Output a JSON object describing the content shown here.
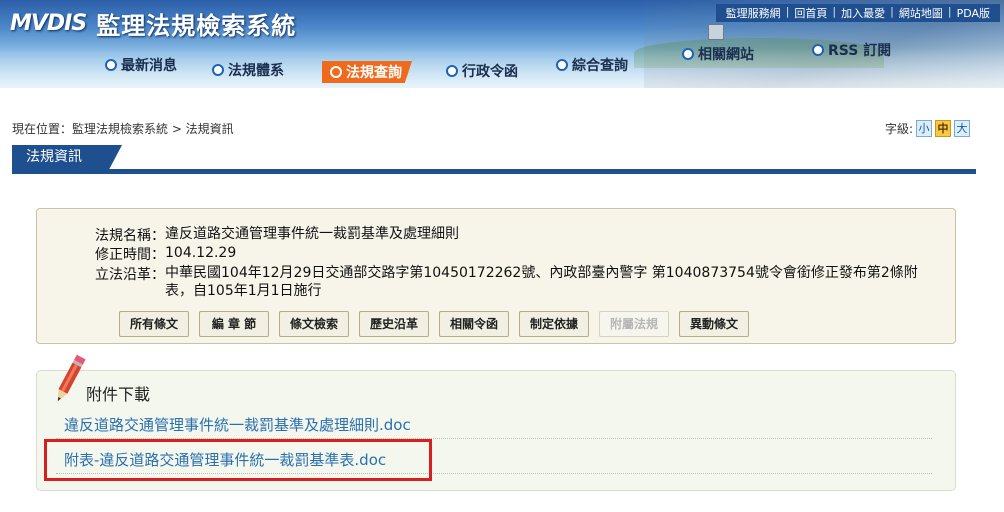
{
  "header": {
    "brand": "MVDIS",
    "system_title": "監理法規檢索系統",
    "top_links": [
      "監理服務網",
      "回首頁",
      "加入最愛",
      "網站地圖",
      "PDA版"
    ],
    "nav": [
      "最新消息",
      "法規體系",
      "法規查詢",
      "行政令函",
      "綜合查詢",
      "相關網站",
      "RSS 訂閱"
    ],
    "active_nav": "法規查詢"
  },
  "breadcrumb": "現在位置：監理法規檢索系統 > 法規資訊",
  "font_size": {
    "label": "字級:",
    "options": [
      "小",
      "中",
      "大"
    ],
    "selected": "中"
  },
  "section_title": "法規資訊",
  "law": {
    "name_label": "法規名稱：",
    "name": "違反道路交通管理事件統一裁罰基準及處理細則",
    "revised_label": "修正時間：",
    "revised": "104.12.29",
    "history_label": "立法沿革：",
    "history": "中華民國104年12月29日交通部交路字第10450172262號、內政部臺內警字 第1040873754號令會銜修正發布第2條附表，自105年1月1日施行"
  },
  "buttons": [
    "所有條文",
    "編 章 節",
    "條文檢索",
    "歷史沿革",
    "相關令函",
    "制定依據",
    "附屬法規",
    "異動條文"
  ],
  "disabled_button": "附屬法規",
  "attachments": {
    "title": "附件下載",
    "files": [
      "違反道路交通管理事件統一裁罰基準及處理細則.doc",
      "附表-違反道路交通管理事件統一裁罰基準表.doc"
    ]
  },
  "colors": {
    "nav_active": "#ef6a1c",
    "section_bar": "#1e4f8f",
    "link": "#2b6fae",
    "highlight": "#d81e1e"
  }
}
